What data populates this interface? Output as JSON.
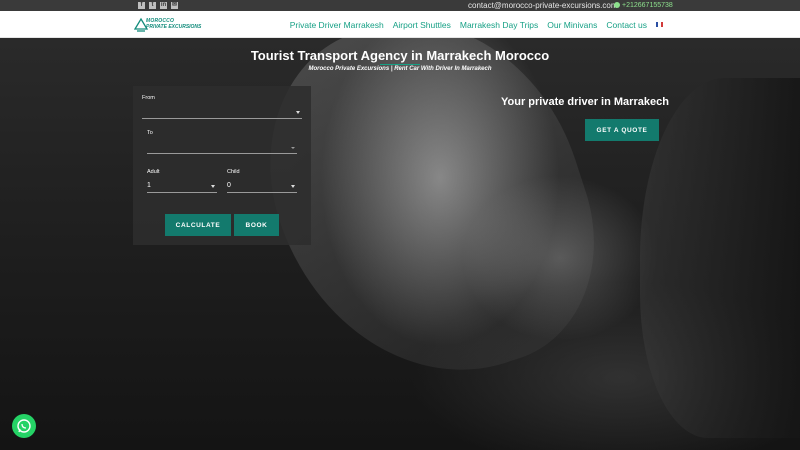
{
  "topbar": {
    "social_icons": [
      "facebook-icon",
      "twitter-icon",
      "linkedin-icon",
      "email-icon"
    ],
    "email": "contact@morocco-private-excursions.com",
    "phone": "+212667155738"
  },
  "logo": {
    "line1": "MOROCCO",
    "line2": "PRIVATE EXCURSIONS"
  },
  "nav": {
    "items": [
      "Private Driver Marrakesh",
      "Airport Shuttles",
      "Marrakesh Day Trips",
      "Our Minivans",
      "Contact us"
    ],
    "language_flag": "french-flag-icon"
  },
  "hero": {
    "title": "Tourist Transport Agency in Marrakech Morocco",
    "subtitle": "Morocco Private Excursions | Rent Car With Driver In Marrakech"
  },
  "booking": {
    "from_label": "From",
    "from_value": "",
    "to_label": "To",
    "to_value": "",
    "adult_label": "Adult",
    "adult_value": "1",
    "child_label": "Child",
    "child_value": "0",
    "calculate_label": "CALCULATE",
    "book_label": "BOOK"
  },
  "promo": {
    "title": "Your private driver in Marrakech",
    "quote_label": "GET A QUOTE"
  },
  "colors": {
    "accent": "#16a085",
    "button": "#137a6d",
    "whatsapp": "#25d366"
  }
}
